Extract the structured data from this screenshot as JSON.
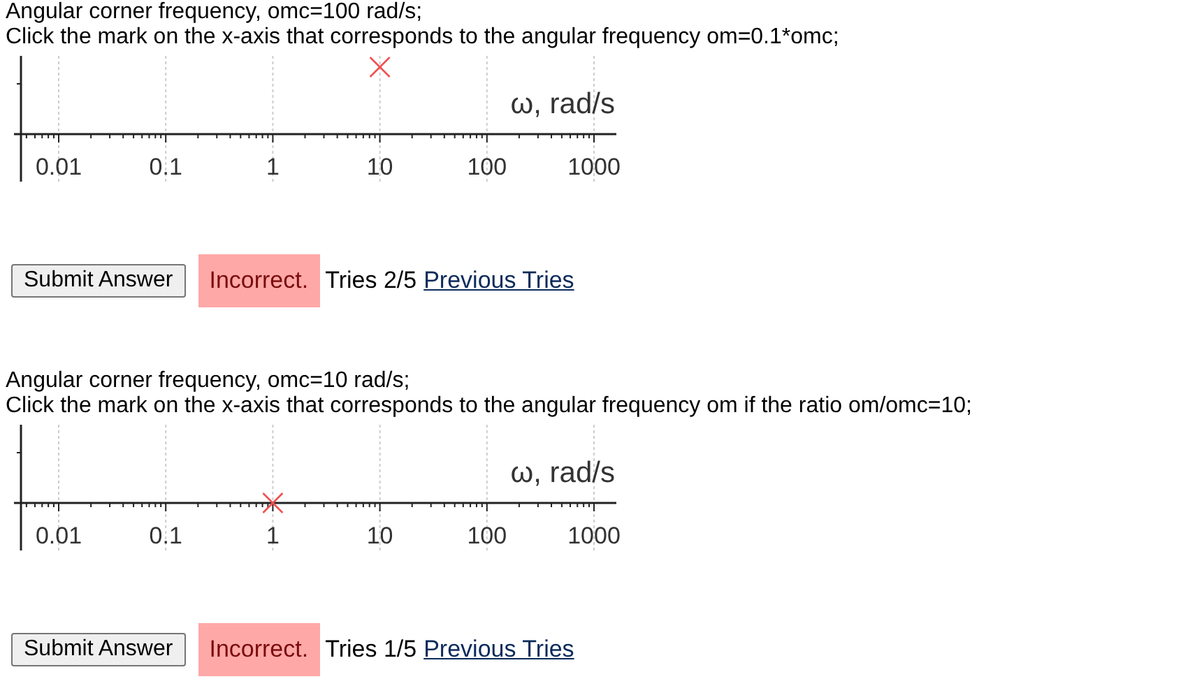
{
  "problems": [
    {
      "statement": "Angular corner frequency, omc=100 rad/s;",
      "question": "Click the mark on the x-axis that corresponds to the angular frequency om=0.1*omc;",
      "axis_label": "ω, rad/s",
      "marker_on_axis": false,
      "ticks": [
        {
          "label": "0.01",
          "selected": false
        },
        {
          "label": "0.1",
          "selected": false
        },
        {
          "label": "1",
          "selected": false
        },
        {
          "label": "10",
          "selected": true
        },
        {
          "label": "100",
          "selected": false
        },
        {
          "label": "1000",
          "selected": false
        }
      ],
      "submit": "Submit Answer",
      "result": "Incorrect.",
      "tries": "Tries 2/5",
      "previous_tries": "Previous Tries"
    },
    {
      "statement": "Angular corner frequency, omc=10 rad/s;",
      "question": "Click the mark on the x-axis that corresponds to the angular frequency om if the ratio om/omc=10;",
      "axis_label": "ω, rad/s",
      "marker_on_axis": true,
      "ticks": [
        {
          "label": "0.01",
          "selected": false
        },
        {
          "label": "0.1",
          "selected": false
        },
        {
          "label": "1",
          "selected": true
        },
        {
          "label": "10",
          "selected": false
        },
        {
          "label": "100",
          "selected": false
        },
        {
          "label": "1000",
          "selected": false
        }
      ],
      "submit": "Submit Answer",
      "result": "Incorrect.",
      "tries": "Tries 1/5",
      "previous_tries": "Previous Tries"
    }
  ]
}
